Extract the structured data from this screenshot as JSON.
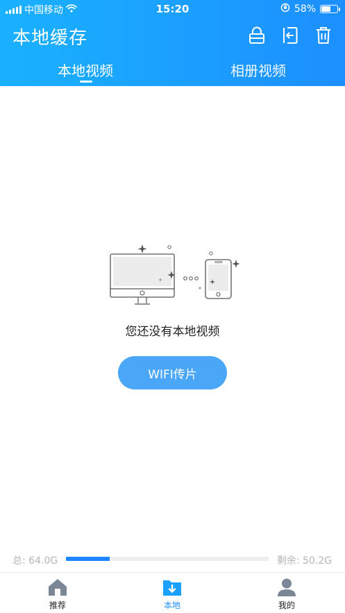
{
  "status_bar": {
    "carrier": "中国移动",
    "time": "15:20",
    "battery": "58%",
    "battery_level": 0.58
  },
  "header": {
    "title": "本地缓存",
    "icons": [
      "lock-icon",
      "exit-icon",
      "trash-icon"
    ]
  },
  "tabs": [
    {
      "label": "本地视频",
      "active": true
    },
    {
      "label": "相册视频",
      "active": false
    }
  ],
  "empty_state": {
    "message": "您还没有本地视频",
    "button_label": "WIFI传片"
  },
  "storage": {
    "total": "总: 64.0G",
    "remaining": "剩余: 50.2G",
    "used_fraction": 0.216
  },
  "bottom_nav": [
    {
      "label": "推荐",
      "icon": "home-icon",
      "active": false
    },
    {
      "label": "本地",
      "icon": "download-folder-icon",
      "active": true
    },
    {
      "label": "我的",
      "icon": "profile-icon",
      "active": false
    }
  ],
  "colors": {
    "header_start": "#1ab1ff",
    "header_end": "#1c8fff",
    "accent": "#1c8fff",
    "button": "#4aa6f6"
  }
}
